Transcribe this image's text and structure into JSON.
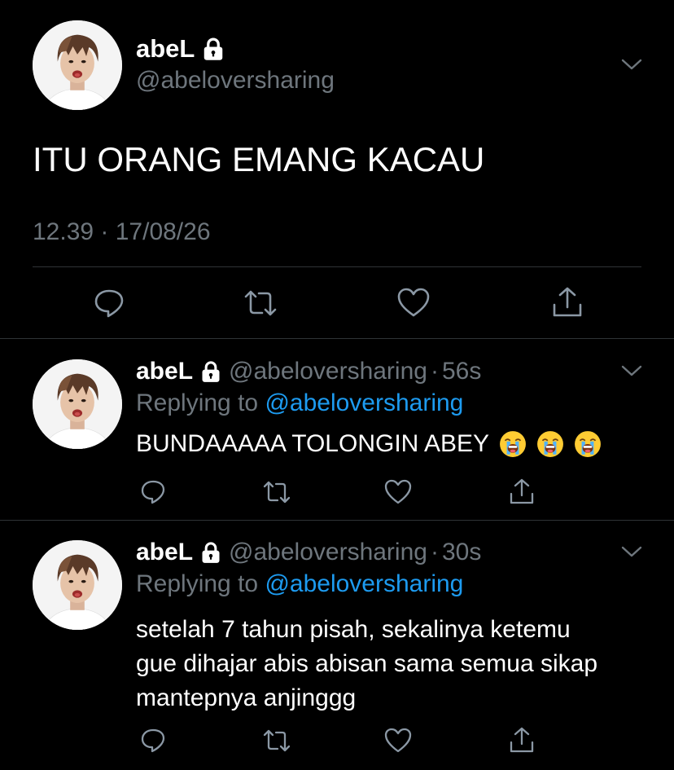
{
  "main_tweet": {
    "display_name": "abeL",
    "handle": "@abeloversharing",
    "text": "ITU ORANG EMANG KACAU",
    "timestamp": "12.39 · 17/08/26",
    "icons": [
      "lock-icon",
      "chevron-down-icon",
      "reply-icon",
      "retweet-icon",
      "like-icon",
      "share-icon"
    ]
  },
  "replies": [
    {
      "display_name": "abeL",
      "handle": "@abeloversharing",
      "time": "56s",
      "replying_prefix": "Replying to",
      "replying_to": "@abeloversharing",
      "text": "BUNDAAAAA TOLONGIN ABEY",
      "emojis": [
        "loudly-crying-face",
        "loudly-crying-face",
        "loudly-crying-face"
      ]
    },
    {
      "display_name": "abeL",
      "handle": "@abeloversharing",
      "time": "30s",
      "replying_prefix": "Replying to",
      "replying_to": "@abeloversharing",
      "text_lines": [
        "setelah 7 tahun pisah, sekalinya ketemu",
        "gue dihajar abis abisan sama semua sikap",
        "mantepnya anjinggg"
      ]
    }
  ],
  "dot": "·",
  "colors": {
    "background": "#000000",
    "muted": "#6e767d",
    "link": "#1d9bf0",
    "divider": "#2f3336"
  }
}
